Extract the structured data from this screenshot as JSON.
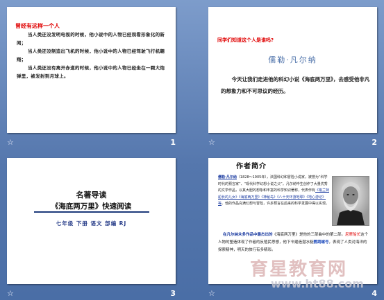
{
  "slides": [
    {
      "number": "1",
      "title": "曾经有这样一个人",
      "paragraphs": [
        "当人类还没发明电视的时候，他小说中的人物已经观看形象化的新闻；",
        "当人类还没制造出飞机的时候，他小说中的人物已经驾驶飞行机翱翔；",
        "当人类还没有离开赤道的时候，他小说中的人物已经坐在一颗大炮弹里，被发射到月球上。"
      ]
    },
    {
      "number": "2",
      "question": "同学们知道这个人是谁吗?",
      "name": "儒勒·凡尔纳",
      "body": "今天让我们走进他的科幻小说《海底两万里》，去感受他非凡的想象力和不可思议的经历。"
    },
    {
      "number": "3",
      "title_line1": "名著导读",
      "title_line2": "《海底两万里》快速阅读",
      "subtitle": "七年级  下册  语文  部编 RJ"
    },
    {
      "number": "4",
      "heading": "作者简介",
      "author_name": "儒勒·凡尔纳",
      "bio_text": "（1828～1905年），法国科幻和冒险小说家，被誉为“科学时代的预言家”、“现代科学幻想小说之父”。凡尔纳毕生创作了大量优秀的文学作品，以其大胆的想象和丰富的科学知识著称，代表作有",
      "works": "《格兰特船长的儿女》《海底两万里》《神秘岛》《八十天环游地球》《地心游记》等",
      "bio_tail": "。他的作品充满幻想与冒险，许多预言在后来的科学发展中得以实现。",
      "note_lead": "在凡尔纳众多作品中最杰出的",
      "note_book": "《海底两万里》",
      "note_mid": "是他的三部曲中的第二部。",
      "note_red": "尼摩船长",
      "note_text": "这个人物的塑造体现了作者的反殖民思想，他下令建造潜水艇",
      "note_em": "鹦鹉螺号",
      "note_end": "，表现了人类对海洋的探索精神，明天的旅行有多精彩。"
    }
  ],
  "star_glyph": "☆",
  "watermark": {
    "line1": "育星教育网",
    "line2": "www.ht88.com"
  }
}
